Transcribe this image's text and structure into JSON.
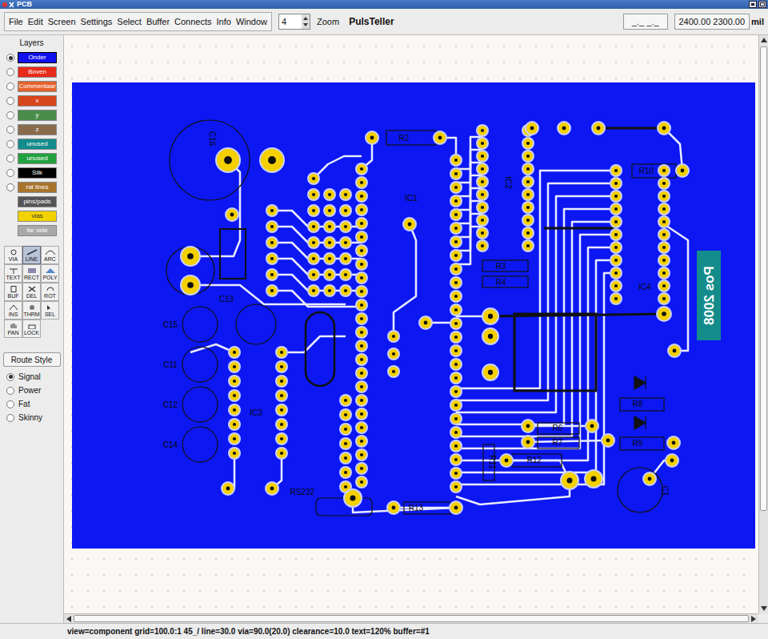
{
  "window": {
    "title": "PCB"
  },
  "menu": [
    "File",
    "Edit",
    "Screen",
    "Settings",
    "Select",
    "Buffer",
    "Connects",
    "Info",
    "Window"
  ],
  "toolbar": {
    "zoom_value": "4",
    "zoom_label": "Zoom",
    "board_name": "PulsTeller",
    "cursor": "_._ _._",
    "coords": "2400.00 2300.00",
    "units": "mil"
  },
  "layers": {
    "title": "Layers",
    "items": [
      {
        "label": "Onder",
        "color": "#1010f0",
        "kind": "radio",
        "selected": true
      },
      {
        "label": "Boven",
        "color": "#e82a18",
        "kind": "radio",
        "selected": false
      },
      {
        "label": "Commentaar",
        "color": "#e4622c",
        "kind": "radio",
        "selected": false
      },
      {
        "label": "x",
        "color": "#d8461c",
        "kind": "radio",
        "selected": false
      },
      {
        "label": "y",
        "color": "#4a8c4a",
        "kind": "radio",
        "selected": false
      },
      {
        "label": "z",
        "color": "#8a6c4c",
        "kind": "radio",
        "selected": false
      },
      {
        "label": "unused",
        "color": "#128c8c",
        "kind": "radio",
        "selected": false
      },
      {
        "label": "unused",
        "color": "#22a23e",
        "kind": "radio",
        "selected": false
      },
      {
        "label": "Silk",
        "color": "#000000",
        "kind": "radio",
        "selected": false
      },
      {
        "label": "rat lines",
        "color": "#a8742c",
        "kind": "radio",
        "selected": false
      },
      {
        "label": "pins/pads",
        "color": "#555555",
        "kind": "plain",
        "selected": false
      },
      {
        "label": "vias",
        "color": "#f2d200",
        "kind": "plain",
        "selected": false
      },
      {
        "label": "far side",
        "color": "#a8a8a8",
        "kind": "plain",
        "selected": false
      }
    ]
  },
  "tools": [
    {
      "label": "VIA",
      "selected": false
    },
    {
      "label": "LINE",
      "selected": true
    },
    {
      "label": "ARC",
      "selected": false
    },
    {
      "label": "TEXT",
      "selected": false
    },
    {
      "label": "RECT",
      "selected": false
    },
    {
      "label": "POLY",
      "selected": false
    },
    {
      "label": "BUF",
      "selected": false
    },
    {
      "label": "DEL",
      "selected": false
    },
    {
      "label": "ROT",
      "selected": false
    },
    {
      "label": "INS",
      "selected": false
    },
    {
      "label": "THRM",
      "selected": false
    },
    {
      "label": "SEL",
      "selected": false
    },
    {
      "label": "PAN",
      "selected": false
    },
    {
      "label": "LOCK",
      "selected": false
    }
  ],
  "route_style": {
    "button": "Route Style",
    "options": [
      {
        "label": "Signal",
        "selected": true
      },
      {
        "label": "Power",
        "selected": false
      },
      {
        "label": "Fat",
        "selected": false
      },
      {
        "label": "Skinny",
        "selected": false
      }
    ]
  },
  "board": {
    "labels": [
      "C16",
      "R2",
      "IC1",
      "IC2",
      "R10",
      "R3",
      "R4",
      "IC4",
      "C13",
      "C15",
      "C11",
      "C12",
      "C14",
      "IC3",
      "RS232",
      "R13",
      "R12",
      "R6",
      "R7",
      "R8",
      "R9",
      "R11",
      "C1"
    ],
    "silk_text": "Pos 2008"
  },
  "status_bar": "view=component grid=100.0:1 45_/ line=30.0 via=90.0(20.0) clearance=10.0 text=120% buffer=#1"
}
